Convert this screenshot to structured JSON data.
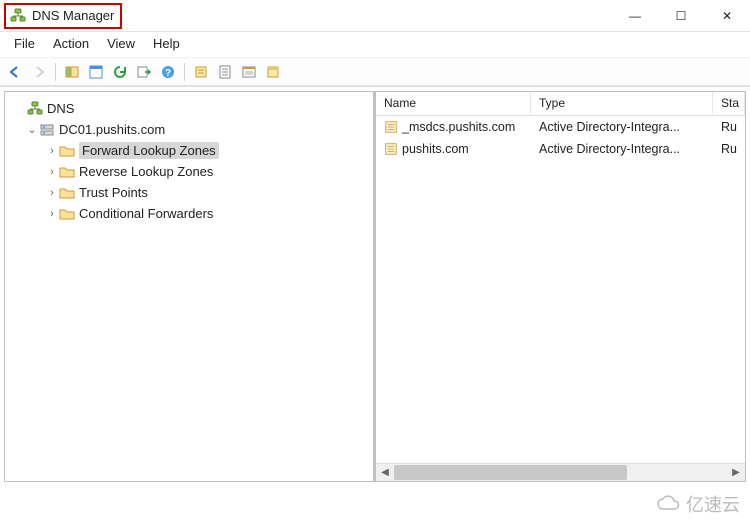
{
  "window": {
    "title": "DNS Manager",
    "controls": {
      "minimize": "—",
      "maximize": "☐",
      "close": "✕"
    }
  },
  "menubar": {
    "file": "File",
    "action": "Action",
    "view": "View",
    "help": "Help"
  },
  "toolbar": {
    "back": "back-arrow",
    "forward": "forward-arrow",
    "up": "up-folder",
    "details": "details-view",
    "refresh": "refresh",
    "export": "export-list",
    "help": "help",
    "event": "event-viewer",
    "stop": "stop",
    "start": "start",
    "filter": "filter"
  },
  "tree": {
    "root": {
      "label": "DNS"
    },
    "server": {
      "label": "DC01.pushits.com",
      "expanded": true
    },
    "children": [
      {
        "label": "Forward Lookup Zones",
        "selected": true
      },
      {
        "label": "Reverse Lookup Zones"
      },
      {
        "label": "Trust Points"
      },
      {
        "label": "Conditional Forwarders"
      }
    ]
  },
  "list": {
    "columns": {
      "name": "Name",
      "type": "Type",
      "status": "Status"
    },
    "columns_short": {
      "status": "Sta"
    },
    "rows": [
      {
        "name": "_msdcs.pushits.com",
        "type": "Active Directory-Integra...",
        "status": "Running",
        "status_short": "Ru"
      },
      {
        "name": "pushits.com",
        "type": "Active Directory-Integra...",
        "status": "Running",
        "status_short": "Ru"
      }
    ]
  },
  "watermark": "亿速云"
}
